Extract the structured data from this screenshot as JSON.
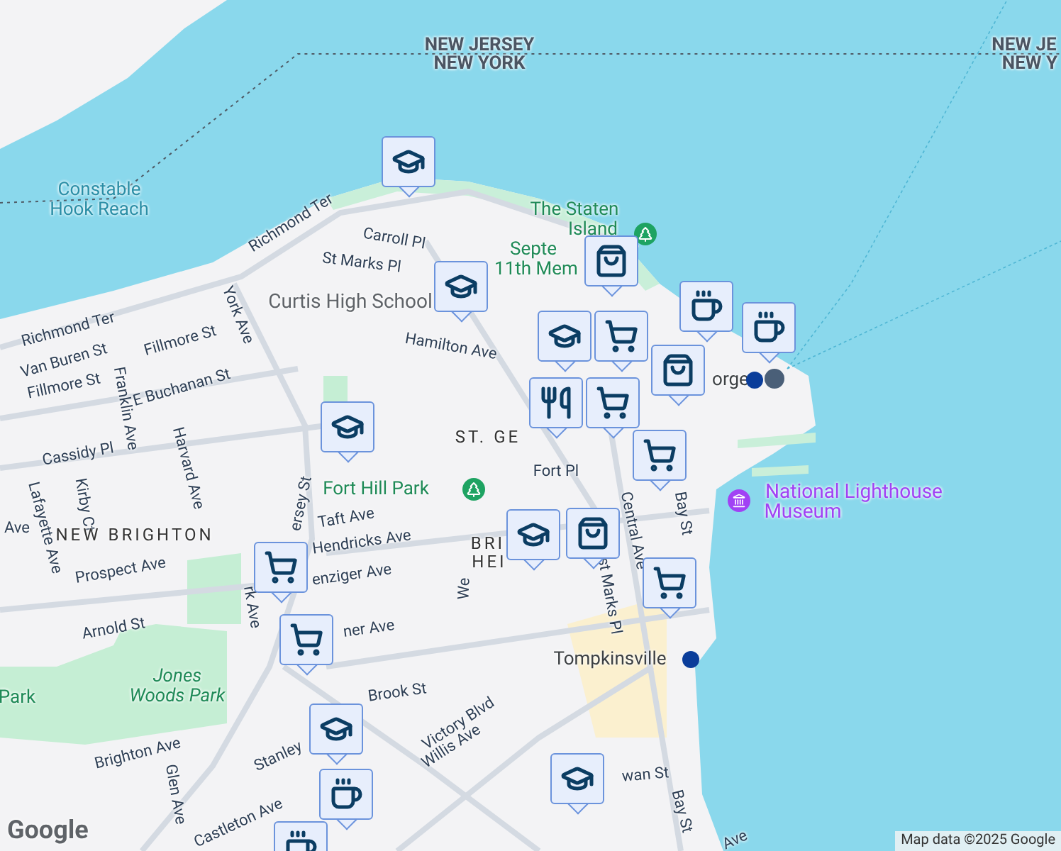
{
  "labels": [
    {
      "text": "NEW JERSEY",
      "kind": "state"
    },
    {
      "text": "NEW YORK",
      "kind": "state"
    },
    {
      "text": "NEW JE",
      "kind": "state"
    },
    {
      "text": "NEW Y",
      "kind": "state"
    },
    {
      "text": "Constable",
      "kind": "water"
    },
    {
      "text": "Hook Reach",
      "kind": "water"
    },
    {
      "text": "The Staten",
      "kind": "park"
    },
    {
      "text": "Island",
      "kind": "park"
    },
    {
      "text": "Septe",
      "kind": "park"
    },
    {
      "text": "11th Mem",
      "kind": "park"
    },
    {
      "text": "Richmond Ter",
      "kind": "street"
    },
    {
      "text": "Richmond Ter",
      "kind": "street"
    },
    {
      "text": "Carroll Pl",
      "kind": "street"
    },
    {
      "text": "St Marks Pl",
      "kind": "street"
    },
    {
      "text": "Curtis High School",
      "kind": "poi"
    },
    {
      "text": "Hamilton Ave",
      "kind": "street"
    },
    {
      "text": "Van Buren St",
      "kind": "street"
    },
    {
      "text": "Fillmore St",
      "kind": "street"
    },
    {
      "text": "Fillmore St",
      "kind": "street"
    },
    {
      "text": "E Buchanan St",
      "kind": "street"
    },
    {
      "text": "Franklin Ave",
      "kind": "street"
    },
    {
      "text": "York Ave",
      "kind": "street"
    },
    {
      "text": "Cassidy Pl",
      "kind": "street"
    },
    {
      "text": "Harvard Ave",
      "kind": "street"
    },
    {
      "text": "Kirby Ct",
      "kind": "street"
    },
    {
      "text": "Lafayette Ave",
      "kind": "street"
    },
    {
      "text": "Ave",
      "kind": "street"
    },
    {
      "text": "NEW BRIGHTON",
      "kind": "area"
    },
    {
      "text": "ST. GE",
      "kind": "area"
    },
    {
      "text": "BRI",
      "kind": "area"
    },
    {
      "text": "HEI",
      "kind": "area"
    },
    {
      "text": "Fort Hill Park",
      "kind": "park"
    },
    {
      "text": "ersey St",
      "kind": "street"
    },
    {
      "text": "Taft Ave",
      "kind": "street"
    },
    {
      "text": "Hendricks Ave",
      "kind": "street"
    },
    {
      "text": "enziger Ave",
      "kind": "street"
    },
    {
      "text": "ner Ave",
      "kind": "street"
    },
    {
      "text": "Prospect Ave",
      "kind": "street"
    },
    {
      "text": "Arnold St",
      "kind": "street"
    },
    {
      "text": "rk Ave",
      "kind": "street"
    },
    {
      "text": "Jones",
      "kind": "parkitalic"
    },
    {
      "text": "Woods Park",
      "kind": "parkitalic"
    },
    {
      "text": "Park",
      "kind": "park"
    },
    {
      "text": "Brighton Ave",
      "kind": "street"
    },
    {
      "text": "Glen Ave",
      "kind": "street"
    },
    {
      "text": "Brook St",
      "kind": "street"
    },
    {
      "text": "Victory Blvd",
      "kind": "street"
    },
    {
      "text": "Willis Ave",
      "kind": "street"
    },
    {
      "text": "Stanley",
      "kind": "street"
    },
    {
      "text": "Castleton Ave",
      "kind": "street"
    },
    {
      "text": "We",
      "kind": "street"
    },
    {
      "text": "Fort Pl",
      "kind": "street"
    },
    {
      "text": "Central Ave",
      "kind": "street"
    },
    {
      "text": "Bay St",
      "kind": "street"
    },
    {
      "text": "st Marks Pl",
      "kind": "street"
    },
    {
      "text": "Tompkinsville",
      "kind": "transit"
    },
    {
      "text": "National Lighthouse",
      "kind": "museum"
    },
    {
      "text": "Museum",
      "kind": "museum"
    },
    {
      "text": "orge",
      "kind": "transit"
    },
    {
      "text": "wan St",
      "kind": "street"
    },
    {
      "text": "Bay St",
      "kind": "street"
    },
    {
      "text": "Ave",
      "kind": "street"
    }
  ],
  "markers": [
    {
      "kind": "school"
    },
    {
      "kind": "school"
    },
    {
      "kind": "shopping"
    },
    {
      "kind": "cafe"
    },
    {
      "kind": "cafe"
    },
    {
      "kind": "school"
    },
    {
      "kind": "grocery"
    },
    {
      "kind": "shopping"
    },
    {
      "kind": "restaurant"
    },
    {
      "kind": "grocery"
    },
    {
      "kind": "shopping"
    },
    {
      "kind": "school"
    },
    {
      "kind": "grocery"
    },
    {
      "kind": "grocery"
    },
    {
      "kind": "grocery"
    },
    {
      "kind": "grocery"
    },
    {
      "kind": "school"
    },
    {
      "kind": "cafe"
    },
    {
      "kind": "school"
    },
    {
      "kind": "school"
    },
    {
      "kind": "cafe"
    }
  ],
  "attribution": "Map data ©2025 Google",
  "logo": "Google"
}
